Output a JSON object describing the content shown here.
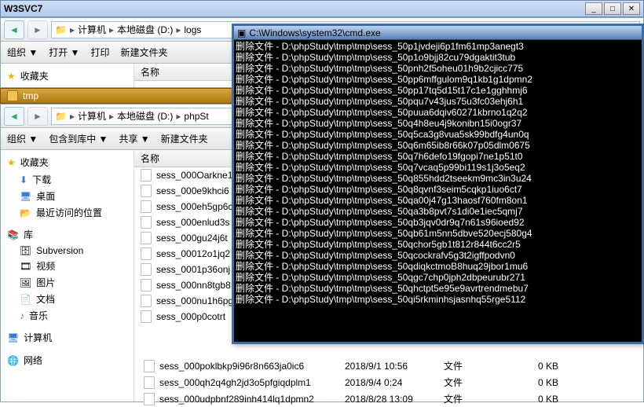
{
  "window": {
    "title": "W3SVC7"
  },
  "explorer1": {
    "breadcrumb": [
      "计算机",
      "本地磁盘 (D:)",
      "logs"
    ],
    "toolbar": {
      "organize": "组织 ▼",
      "open": "打开 ▼",
      "print": "打印",
      "newfolder": "新建文件夹"
    },
    "sidebar": {
      "favorites": "收藏夹"
    },
    "listhead": "名称"
  },
  "tab2": {
    "label": "tmp"
  },
  "explorer2": {
    "breadcrumb": [
      "计算机",
      "本地磁盘 (D:)",
      "phpSt"
    ],
    "toolbar": {
      "organize": "组织 ▼",
      "include": "包含到库中 ▼",
      "share": "共享 ▼",
      "newfolder": "新建文件夹"
    },
    "sidebar": {
      "favorites": "收藏夹",
      "fav_items": [
        "下载",
        "桌面",
        "最近访问的位置"
      ],
      "library": "库",
      "lib_items": [
        "Subversion",
        "视频",
        "图片",
        "文档",
        "音乐"
      ],
      "computer": "计算机",
      "network": "网络"
    },
    "listhead": "名称",
    "files": [
      "sess_000Oarkne1",
      "sess_000e9khci6",
      "sess_000eh5gp6c",
      "sess_000enlud3s",
      "sess_000gu24j6t",
      "sess_00012o1jq2",
      "sess_0001p36onj",
      "sess_000nn8tgb8",
      "sess_000nu1h6pg",
      "sess_000p0cotrt"
    ],
    "bottom_rows": [
      {
        "name": "sess_000poklbkp9i96r8n663ja0ic6",
        "date": "2018/9/1 10:56",
        "type": "文件",
        "size": "0 KB"
      },
      {
        "name": "sess_000qh2q4gh2jd3o5pfgiqdplm1",
        "date": "2018/9/4 0:24",
        "type": "文件",
        "size": "0 KB"
      },
      {
        "name": "sess_000udpbnf289inh414lq1dpmn2",
        "date": "2018/8/28 13:09",
        "type": "文件",
        "size": "0 KB"
      }
    ]
  },
  "cmd": {
    "title": "C:\\Windows\\system32\\cmd.exe",
    "prefix": "删除文件 - ",
    "lines": [
      "D:\\phpStudy\\tmp\\tmp\\sess_50p1jvdeji6p1fm61mp3anegt3",
      "D:\\phpStudy\\tmp\\tmp\\sess_50p1o9bjj82cu79dgaktit3tub",
      "D:\\phpStudy\\tmp\\tmp\\sess_50pnh2f5oheu01h9b2cjicc775",
      "D:\\phpStudy\\tmp\\tmp\\sess_50pp6mffgulom9q1kb1g1dpmn2",
      "D:\\phpStudy\\tmp\\tmp\\sess_50pp17tq5d15t17c1e1gghhmj6",
      "D:\\phpStudy\\tmp\\tmp\\sess_50pqu7v43jus75u3fc03ehj6h1",
      "D:\\phpStudy\\tmp\\tmp\\sess_50puua6dqiv60271kbrno1q2q2",
      "D:\\phpStudy\\tmp\\tmp\\sess_50q4h8eu4j9konibn15i0ogr37",
      "D:\\phpStudy\\tmp\\tmp\\sess_50q5ca3g8vua5sk99bdfg4un0q",
      "D:\\phpStudy\\tmp\\tmp\\sess_50q6m65ib8r66k07p05dlm0675",
      "D:\\phpStudy\\tmp\\tmp\\sess_50q7h6defo19fgopi7ne1p51t0",
      "D:\\phpStudy\\tmp\\tmp\\sess_50q7vcaq5p99bi119s1j3o5eq2",
      "D:\\phpStudy\\tmp\\tmp\\sess_50q855hdd2tseekm9mc3in3u24",
      "D:\\phpStudy\\tmp\\tmp\\sess_50q8qvnf3seim5cqkp1iuo6ct7",
      "D:\\phpStudy\\tmp\\tmp\\sess_50qa00j47g13haosf760fm8on1",
      "D:\\phpStudy\\tmp\\tmp\\sess_50qa3b8pvt7s1di0e1iec5qmj7",
      "D:\\phpStudy\\tmp\\tmp\\sess_50qb3jqv0dr9q7n61s96ioed92",
      "D:\\phpStudy\\tmp\\tmp\\sess_50qb61m5nn5dbve520ecj580g4",
      "D:\\phpStudy\\tmp\\tmp\\sess_50qchor5gb1t812r844t6cc2r5",
      "D:\\phpStudy\\tmp\\tmp\\sess_50qcockrafv5g3t2igffpodvn0",
      "D:\\phpStudy\\tmp\\tmp\\sess_50qdiqkctmoB8huq29jbor1mu6",
      "D:\\phpStudy\\tmp\\tmp\\sess_50qgc7chp0jph2dbpeurubr271",
      "D:\\phpStudy\\tmp\\tmp\\sess_50qhctpt5e95e9avrtrendmebu7",
      "D:\\phpStudy\\tmp\\tmp\\sess_50qi5rkminhsjasnhq55rge5112"
    ]
  }
}
